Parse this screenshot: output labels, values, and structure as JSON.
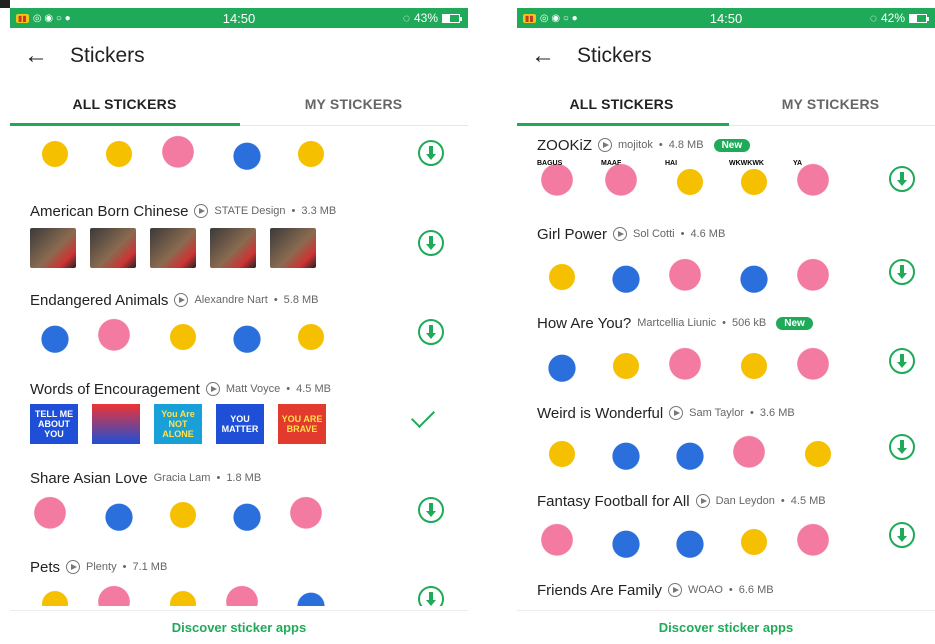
{
  "status_left": {
    "time": "14:50",
    "battery": "43%",
    "battery_level": 0.43
  },
  "status_right": {
    "time": "14:50",
    "battery": "42%",
    "battery_level": 0.42
  },
  "screen_title": "Stickers",
  "tabs": {
    "all": "ALL STICKERS",
    "mine": "MY STICKERS"
  },
  "footer": "Discover sticker apps",
  "left_packs": [
    {
      "name": "American Born Chinese",
      "author": "STATE Design",
      "size": "3.3 MB"
    },
    {
      "name": "Endangered Animals",
      "author": "Alexandre Nart",
      "size": "5.8 MB"
    },
    {
      "name": "Words of Encouragement",
      "author": "Matt Voyce",
      "size": "4.5 MB"
    },
    {
      "name": "Share Asian Love",
      "author": "Gracia Lam",
      "size": "1.8 MB"
    },
    {
      "name": "Pets",
      "author": "Plenty",
      "size": "7.1 MB"
    }
  ],
  "left_posters": [
    "TELL ME ABOUT YOU",
    "",
    "You Are NOT ALONE",
    "YOU MATTER",
    "YOU ARE BRAVE"
  ],
  "right_packs": [
    {
      "name": "ZOOKiZ",
      "author": "mojitok",
      "size": "4.8 MB",
      "badge": "New"
    },
    {
      "name": "Girl Power",
      "author": "Sol Cotti",
      "size": "4.6 MB"
    },
    {
      "name": "How Are You?",
      "author": "Martcellia Liunic",
      "size": "506 kB",
      "badge": "New"
    },
    {
      "name": "Weird is Wonderful",
      "author": "Sam Taylor",
      "size": "3.6 MB"
    },
    {
      "name": "Fantasy Football for All",
      "author": "Dan Leydon",
      "size": "4.5 MB"
    },
    {
      "name": "Friends Are Family",
      "author": "WOAO",
      "size": "6.6 MB"
    }
  ],
  "zookiz_labels": [
    "BAGUS",
    "MAAF",
    "HAI",
    "WKWKWK",
    "YA"
  ],
  "colors": {
    "accent": "#1faa59",
    "status_bar": "#1faa59"
  }
}
